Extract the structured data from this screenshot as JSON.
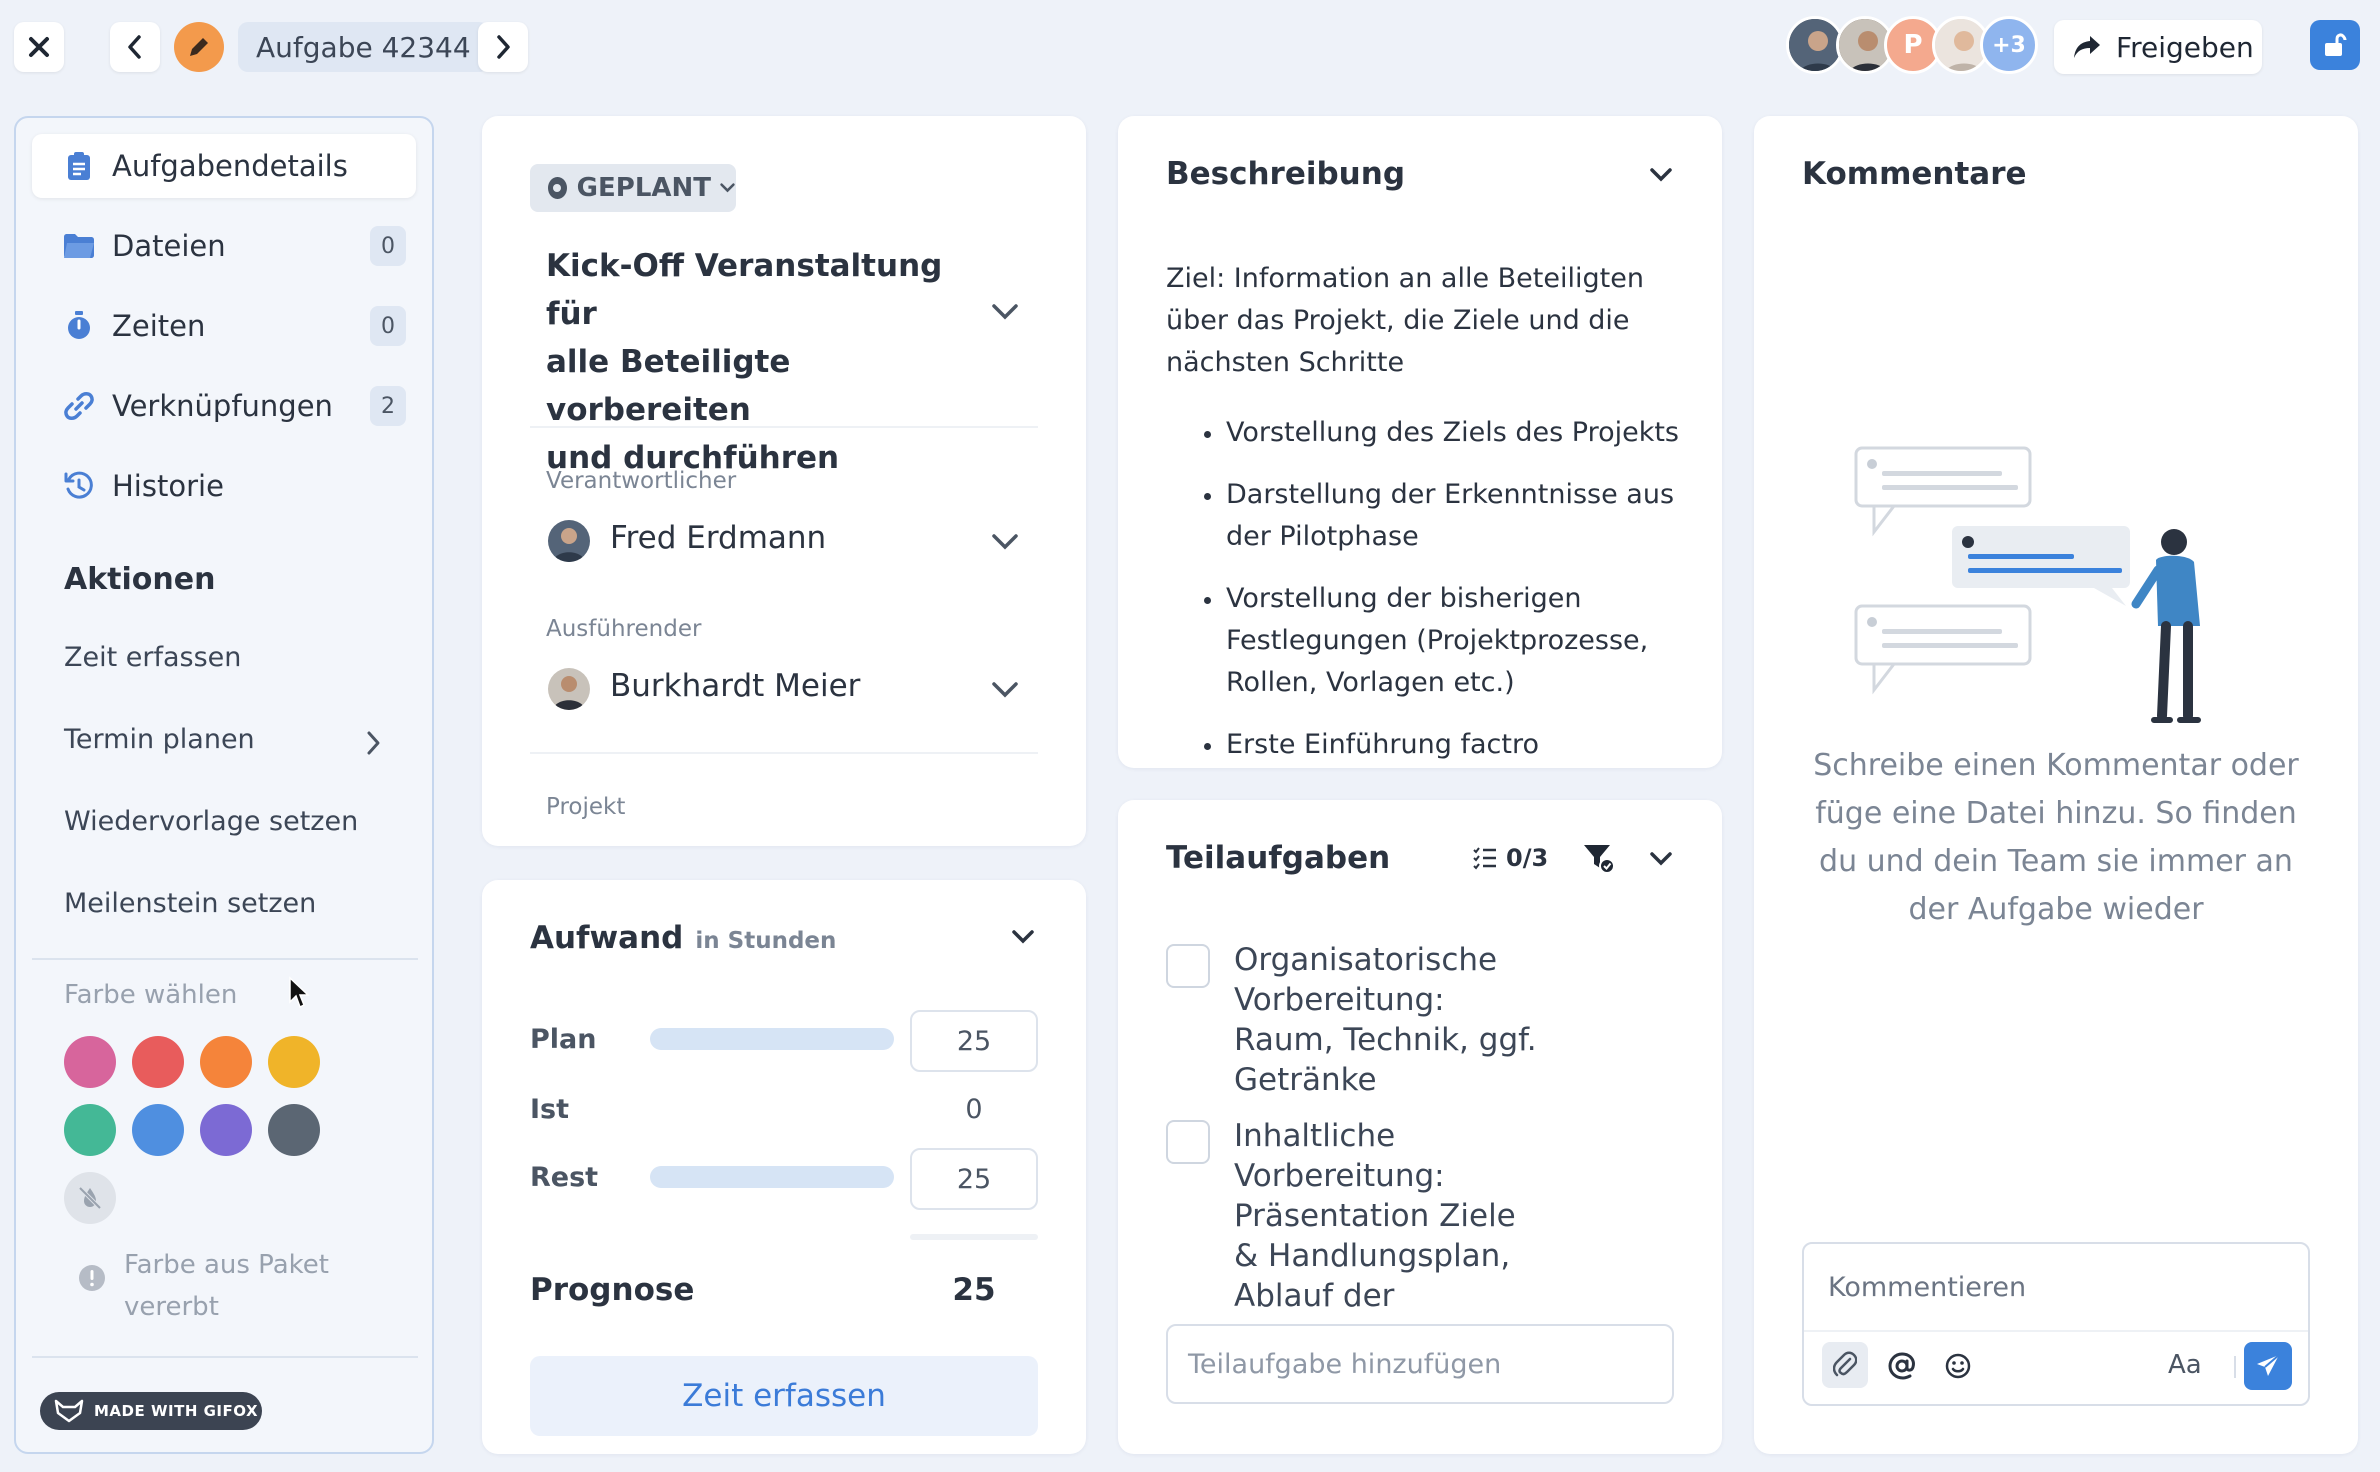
{
  "topbar": {
    "task_label": "Aufgabe 42344",
    "avatars_more": "+3",
    "avatar_initial": "P",
    "share_label": "Freigeben"
  },
  "sidebar": {
    "items": [
      {
        "label": "Aufgabendetails",
        "icon": "clipboard-icon"
      },
      {
        "label": "Dateien",
        "count": "0",
        "icon": "folder-icon"
      },
      {
        "label": "Zeiten",
        "count": "0",
        "icon": "stopwatch-icon"
      },
      {
        "label": "Verknüpfungen",
        "count": "2",
        "icon": "link-icon"
      },
      {
        "label": "Historie",
        "icon": "history-icon"
      }
    ],
    "actions_title": "Aktionen",
    "actions": [
      "Zeit erfassen",
      "Termin planen",
      "Wiedervorlage setzen",
      "Meilenstein setzen"
    ],
    "color_title": "Farbe wählen",
    "colors": [
      "#d7659c",
      "#e85c5c",
      "#f5843a",
      "#f0b429",
      "#44b896",
      "#4f8fe0",
      "#7c6ad4",
      "#5b6673"
    ],
    "inherit_note": "Farbe aus Paket vererbt",
    "gifox_badge": "MADE WITH GIFOX"
  },
  "task": {
    "status": "GEPLANT",
    "title_lines": [
      "Kick-Off Veranstaltung für",
      "alle Beteiligte vorbereiten",
      "und durchführen"
    ],
    "responsible_label": "Verantwortlicher",
    "responsible_name": "Fred Erdmann",
    "executor_label": "Ausführender",
    "executor_name": "Burkhardt Meier",
    "project_label": "Projekt"
  },
  "effort": {
    "title": "Aufwand",
    "unit": "in Stunden",
    "plan_label": "Plan",
    "plan_value": "25",
    "ist_label": "Ist",
    "ist_value": "0",
    "rest_label": "Rest",
    "rest_value": "25",
    "prognose_label": "Prognose",
    "prognose_value": "25",
    "button_label": "Zeit erfassen"
  },
  "description": {
    "title": "Beschreibung",
    "intro_lines": [
      "Ziel: Information an alle Beteiligten",
      "über das Projekt, die Ziele und die",
      "nächsten Schritte"
    ],
    "bullets": [
      [
        "Vorstellung des Ziels des Projekts"
      ],
      [
        "Darstellung der Erkenntnisse aus",
        "der Pilotphase"
      ],
      [
        "Vorstellung der bisherigen",
        "Festlegungen (Projektprozesse,",
        "Rollen, Vorlagen etc.)"
      ],
      [
        "Erste Einführung factro"
      ]
    ]
  },
  "subtasks": {
    "title": "Teilaufgaben",
    "count": "0/3",
    "items": [
      [
        "Organisatorische",
        "Vorbereitung:",
        "Raum, Technik, ggf.",
        "Getränke"
      ],
      [
        "Inhaltliche",
        "Vorbereitung:",
        "Präsentation Ziele",
        "& Handlungsplan,",
        "Ablauf der"
      ]
    ],
    "add_placeholder": "Teilaufgabe hinzufügen"
  },
  "comments": {
    "title": "Kommentare",
    "empty_lines": [
      "Schreibe einen Kommentar oder",
      "füge eine Datei hinzu. So finden",
      "du und dein Team sie immer an",
      "der Aufgabe wieder"
    ],
    "input_placeholder": "Kommentieren",
    "format_label": "Aa"
  }
}
